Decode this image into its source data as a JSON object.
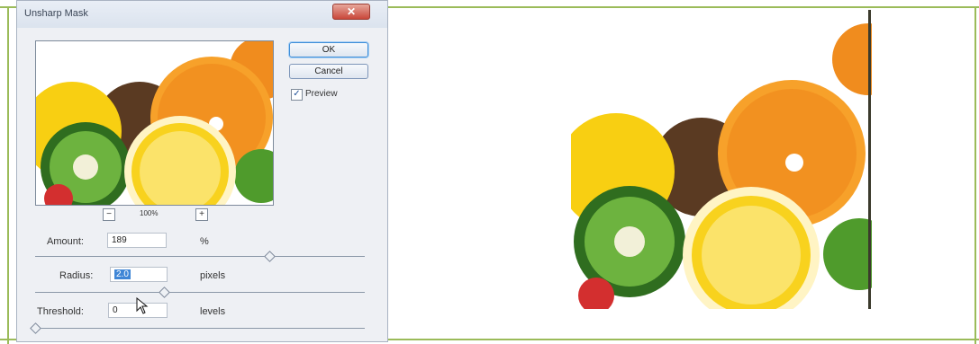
{
  "dialog": {
    "title": "Unsharp Mask",
    "close_glyph": "✕",
    "zoom_label": "100%",
    "zoom_minus_glyph": "−",
    "zoom_plus_glyph": "+",
    "ok_label": "OK",
    "cancel_label": "Cancel",
    "preview_label": "Preview",
    "preview_checked": true,
    "amount": {
      "label": "Amount:",
      "value": "189",
      "unit": "%",
      "slider_value": 0.71
    },
    "radius": {
      "label": "Radius:",
      "value": "2.0",
      "unit": "pixels",
      "slider_value": 0.39
    },
    "threshold": {
      "label": "Threshold:",
      "value": "0",
      "unit": "levels",
      "slider_value": 0.0
    }
  },
  "icons": {
    "checkbox": "check-icon",
    "cursor": "pointer-cursor-icon",
    "close": "close-icon"
  },
  "colors": {
    "frame": "#9bbb59",
    "accent": "#3d8dd8",
    "close": "#c9473a",
    "orange": "#f08c1e",
    "lemon": "#f8d21e",
    "kiwi": "#4f9b2c"
  }
}
